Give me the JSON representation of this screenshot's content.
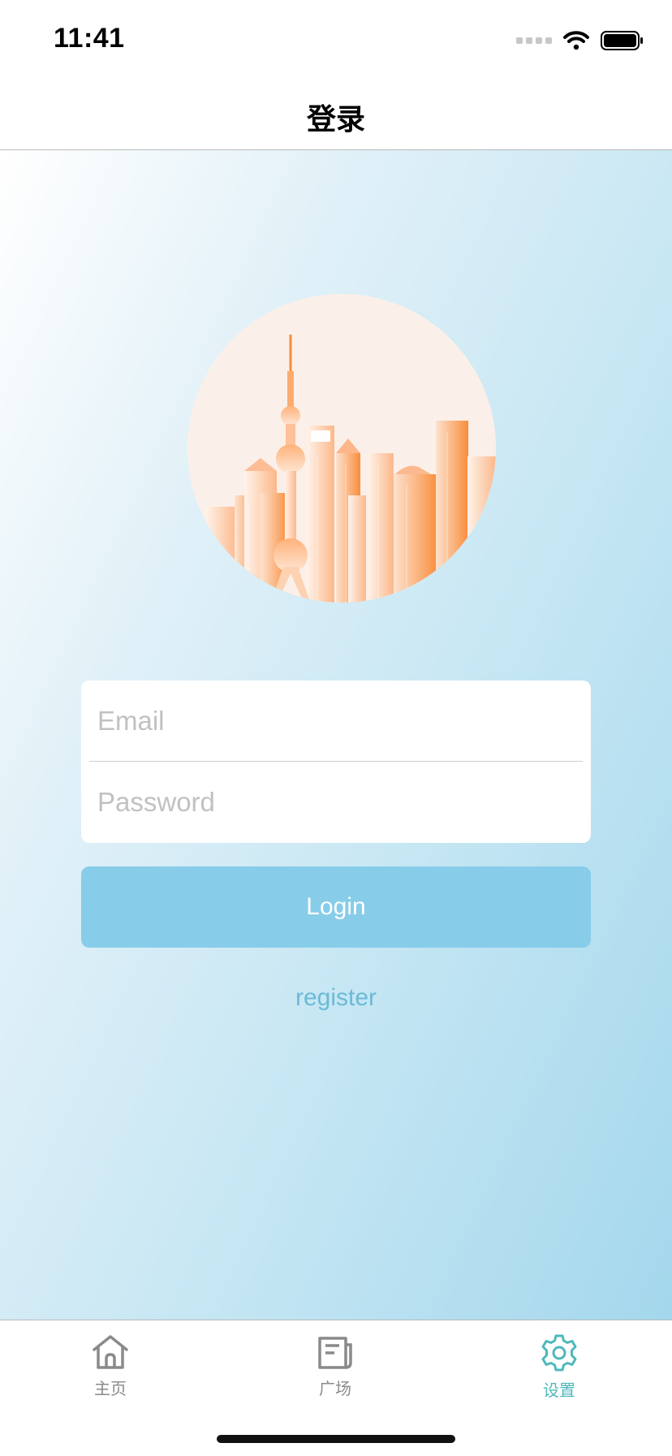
{
  "status_bar": {
    "time": "11:41",
    "wifi_icon": "wifi-icon",
    "battery_icon": "battery-icon"
  },
  "nav": {
    "title": "登录"
  },
  "hero": {
    "image": "city-skyline-illustration"
  },
  "form": {
    "email_placeholder": "Email",
    "password_placeholder": "Password"
  },
  "login_button": {
    "label": "Login"
  },
  "register_link": {
    "label": "register"
  },
  "tabs": [
    {
      "label": "主页",
      "icon": "home-icon",
      "active": false
    },
    {
      "label": "广场",
      "icon": "document-icon",
      "active": false
    },
    {
      "label": "设置",
      "icon": "gear-icon",
      "active": true
    }
  ],
  "colors": {
    "accent": "#87cdea",
    "link": "#6bbad7",
    "active_tab": "#4fb8ba",
    "inactive_tab": "#8a8a8a"
  }
}
